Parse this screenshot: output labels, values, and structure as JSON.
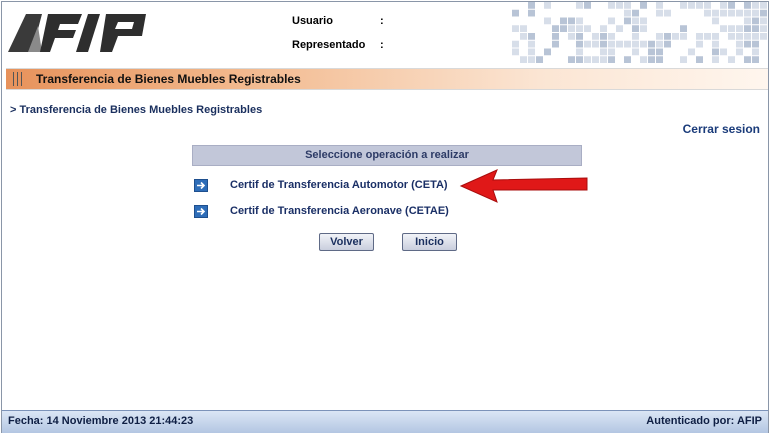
{
  "header": {
    "logo_text": "AFIP",
    "usuario_label": "Usuario",
    "representado_label": "Representado",
    "separator": ":"
  },
  "title_band": {
    "title": "Transferencia de Bienes Muebles Registrables"
  },
  "breadcrumb": {
    "text": "> Transferencia de Bienes Muebles Registrables"
  },
  "session": {
    "logout_label": "Cerrar sesion"
  },
  "selection": {
    "header": "Seleccione operación a realizar",
    "options": [
      {
        "label": "Certif de Transferencia Automotor (CETA)",
        "icon": "arrow-right-icon"
      },
      {
        "label": "Certif de Transferencia Aeronave (CETAE)",
        "icon": "arrow-right-icon"
      }
    ]
  },
  "buttons": {
    "back": "Volver",
    "home": "Inicio"
  },
  "footer": {
    "date": "Fecha: 14 Noviembre 2013 21:44:23",
    "auth": "Autenticado por: AFIP"
  },
  "colors": {
    "accent_orange": "#e7925b",
    "selection_header": "#c2c7d9",
    "icon_blue": "#2e6db8",
    "pointer_red": "#e01818"
  }
}
